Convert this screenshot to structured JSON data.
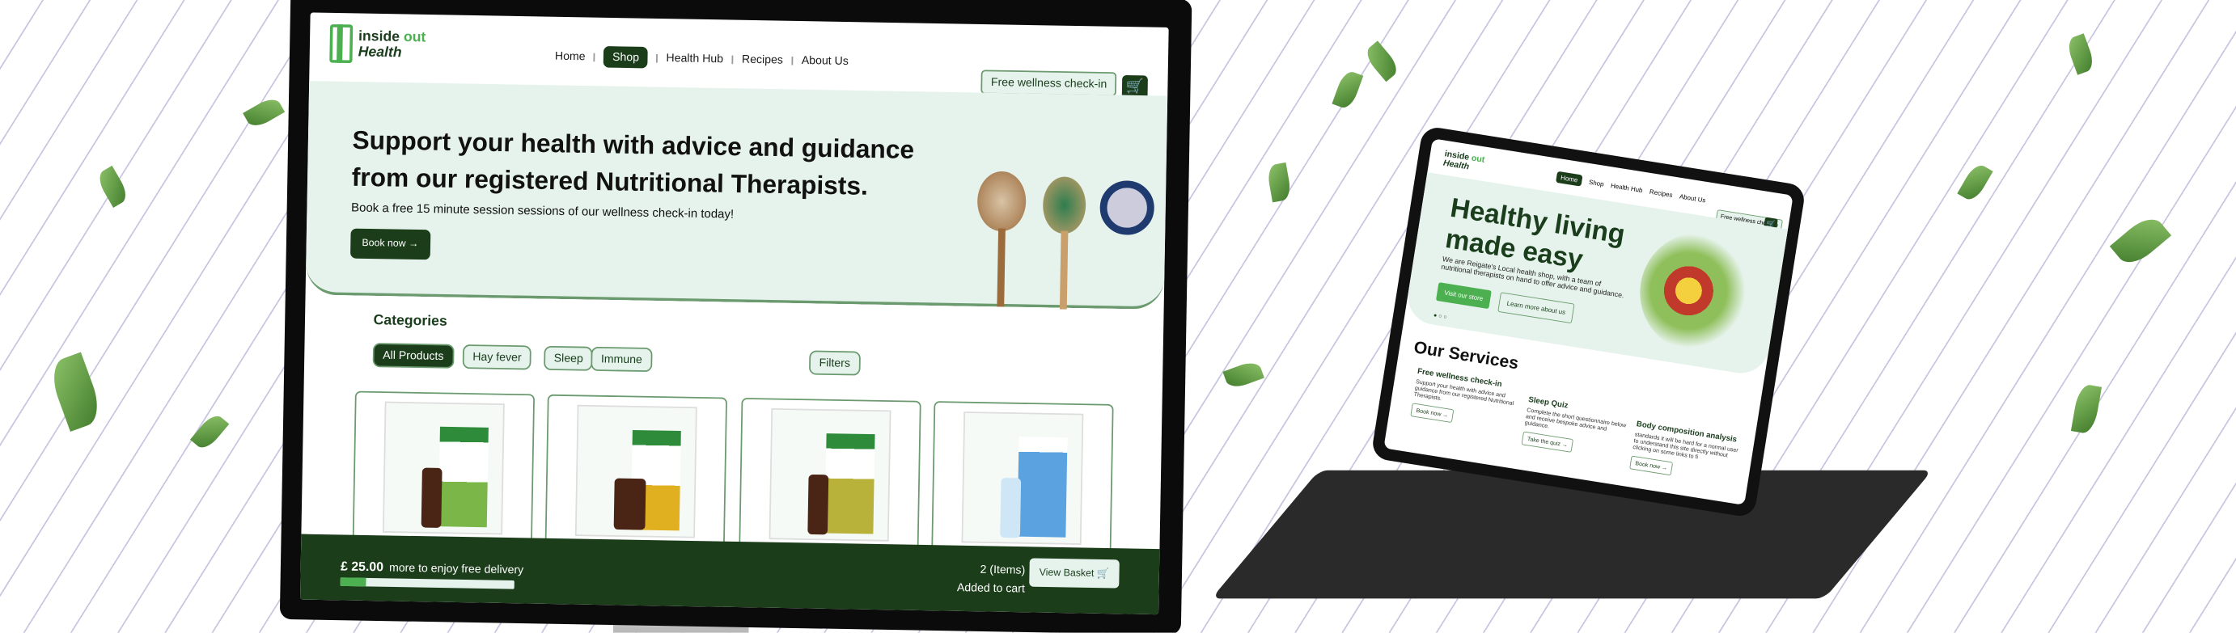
{
  "desktop": {
    "logo": {
      "line1": "inside",
      "line1_accent": "out",
      "line2": "Health"
    },
    "nav": [
      {
        "label": "Home",
        "active": false
      },
      {
        "label": "Shop",
        "active": true
      },
      {
        "label": "Health Hub",
        "active": false
      },
      {
        "label": "Recipes",
        "active": false
      },
      {
        "label": "About Us",
        "active": false
      }
    ],
    "checkin_button": "Free wellness check-in",
    "cart_icon": "cart-icon",
    "hero": {
      "heading": "Support your health with advice and guidance from our registered Nutritional Therapists.",
      "subtitle": "Book a free 15 minute session sessions of our  wellness check-in today!",
      "cta": "Book now →"
    },
    "categories_title": "Categories",
    "categories": [
      {
        "label": "All Products",
        "active": true
      },
      {
        "label": "Hay fever",
        "active": false
      },
      {
        "label": "Sleep",
        "active": false
      },
      {
        "label": "Immune",
        "active": false
      }
    ],
    "filters_button": "Filters",
    "basket_bar": {
      "amount": "£ 25.00",
      "message": "more to enjoy free delivery",
      "progress": 0.15,
      "items": "2 (Items)",
      "added": "Added to cart",
      "view_basket": "View Basket"
    }
  },
  "tablet": {
    "logo": {
      "line1": "inside",
      "line1_accent": "out",
      "line2": "Health"
    },
    "nav": [
      {
        "label": "Home",
        "active": true
      },
      {
        "label": "Shop",
        "active": false
      },
      {
        "label": "Health Hub",
        "active": false
      },
      {
        "label": "Recipes",
        "active": false
      },
      {
        "label": "About Us",
        "active": false
      }
    ],
    "checkin_button": "Free wellness check-in",
    "hero": {
      "heading_line1": "Healthy living",
      "heading_line2": "made easy",
      "text": "We are Reigate's Local health shop, with a team of nutritional therapists on hand to offer advice and guidance.",
      "primary": "Visit our store",
      "secondary": "Learn more about us"
    },
    "services_title": "Our Services",
    "services": [
      {
        "title": "Free wellness check-in",
        "text": "Support your health with advice and guidance from our registered Nutritional Therapists.",
        "button": "Book now →"
      },
      {
        "title": "Sleep Quiz",
        "text": "Complete the short questionnaire below and receive bespoke advice and guidance.",
        "button": "Take the quiz →"
      },
      {
        "title": "Body composition analysis",
        "text": "standards it will be hard for a normal user to understand this site directly without clicking on some links to fi",
        "button": "Book now →"
      }
    ]
  },
  "colors": {
    "brand_dark": "#1b3d1a",
    "brand_green": "#4caf50",
    "mint": "#e6f3ec"
  }
}
